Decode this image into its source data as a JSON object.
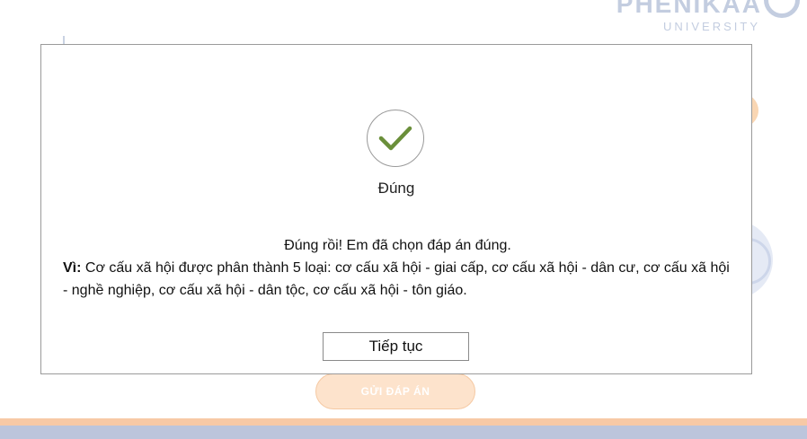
{
  "brand": {
    "name": "PHENIKAA",
    "sub": "UNIVERSITY"
  },
  "background": {
    "submit_label": "GỬI ĐÁP ÁN"
  },
  "modal": {
    "status_icon": "check-icon",
    "status_color": "#6a8f3a",
    "title": "Đúng",
    "message_line1": "Đúng rồi! Em đã chọn đáp án đúng.",
    "why_label": "Vì:",
    "why_text": " Cơ cấu xã hội được phân thành 5 loại: cơ cấu xã hội - giai cấp, cơ cấu xã hội - dân cư, cơ cấu xã hội - nghề nghiệp, cơ cấu xã hội - dân tộc, cơ cấu xã hội - tôn giáo.",
    "continue_label": "Tiếp tục"
  }
}
